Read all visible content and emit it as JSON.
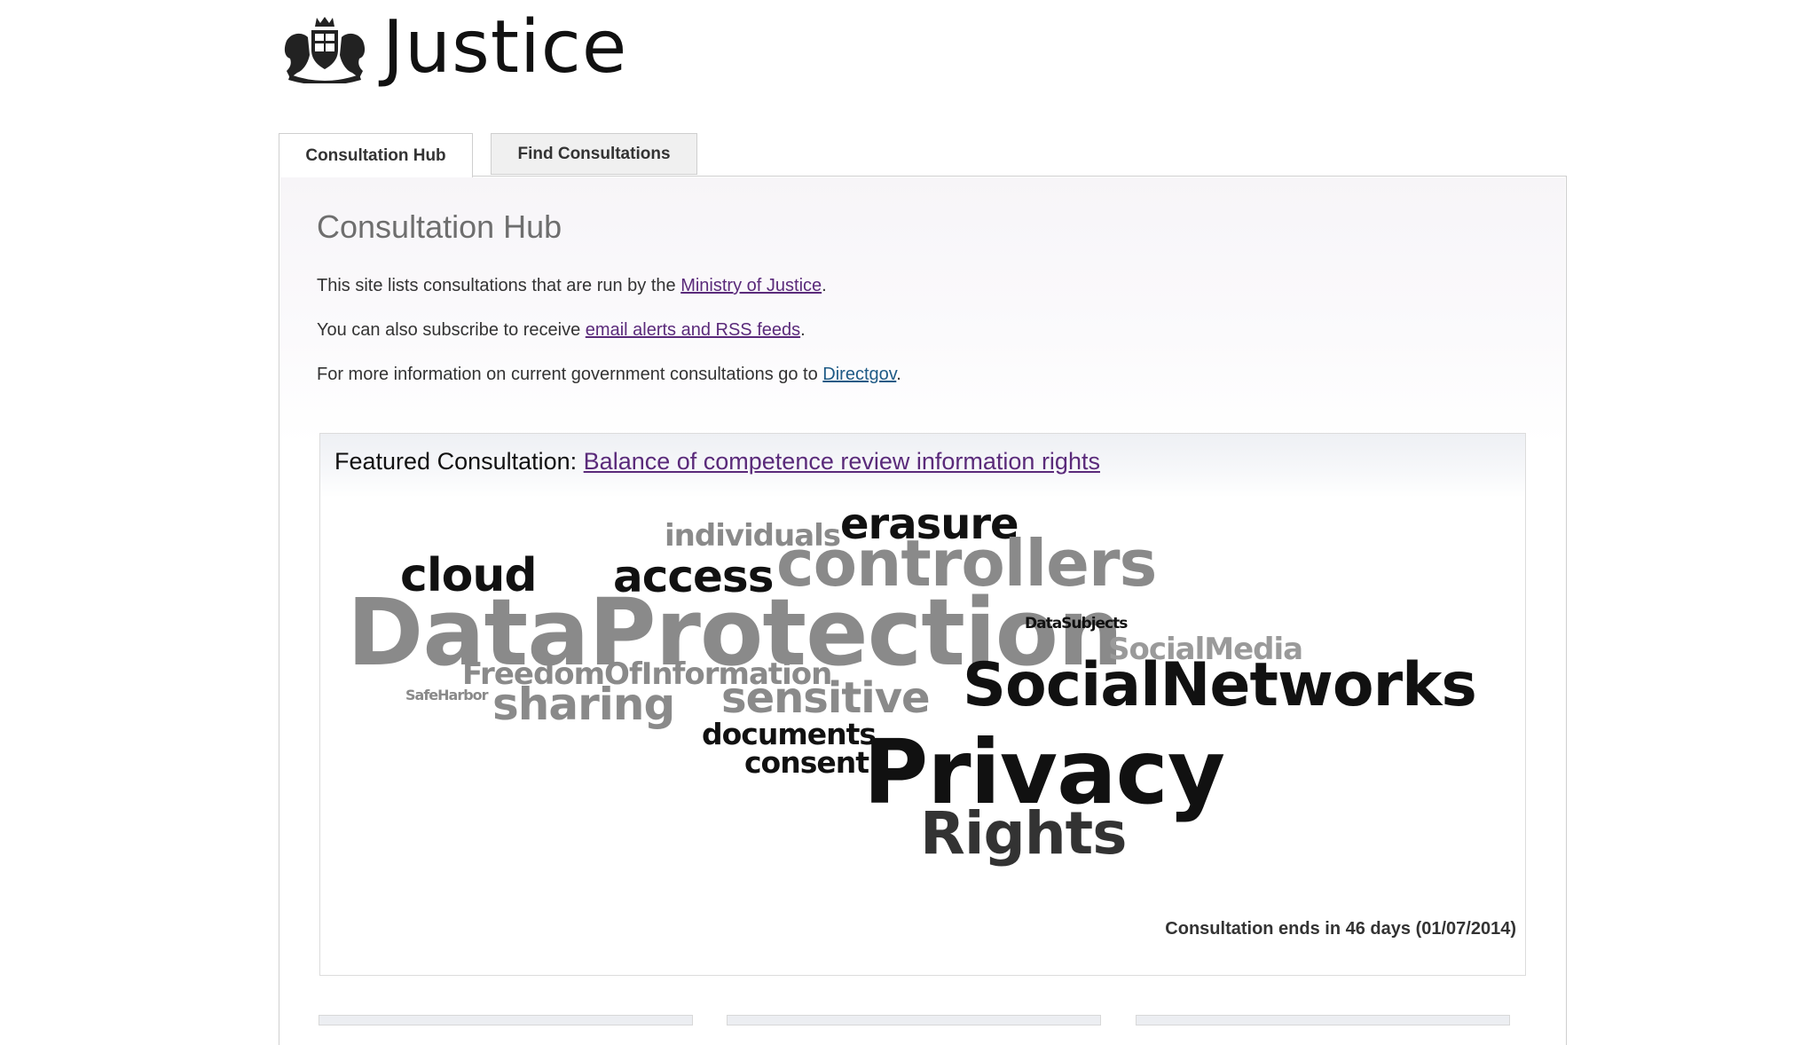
{
  "brand": {
    "logo_text": "Justice",
    "crest_icon": "royal-coat-of-arms-icon"
  },
  "tabs": [
    {
      "label": "Consultation Hub",
      "active": true
    },
    {
      "label": "Find Consultations",
      "active": false
    }
  ],
  "hub": {
    "title": "Consultation Hub",
    "p1_before": "This site lists consultations that are run by the ",
    "p1_link": "Ministry of Justice",
    "p1_after": ".",
    "p2_before": "You can also subscribe to receive ",
    "p2_link": "email alerts and RSS feeds",
    "p2_after": ".",
    "p3_before": "For more information on current government consultations go to ",
    "p3_link": "Directgov",
    "p3_after": "."
  },
  "featured": {
    "label": "Featured Consultation: ",
    "link": "Balance of competence review information rights",
    "ends": "Consultation ends in 46 days (01/07/2014)",
    "word_cloud": [
      "erasure",
      "individuals",
      "cloud",
      "access",
      "controllers",
      "DataProtection",
      "DataSubjects",
      "SocialMedia",
      "FreedomOfInformation",
      "SafeHarbor",
      "sharing",
      "sensitive",
      "SocialNetworks",
      "documents",
      "consent",
      "Privacy",
      "Rights"
    ]
  },
  "colors": {
    "link_purple": "#5a2a7a",
    "link_blue": "#1f5b86",
    "cloud_dark": "#111111",
    "cloud_gray": "#8a8a8a"
  }
}
